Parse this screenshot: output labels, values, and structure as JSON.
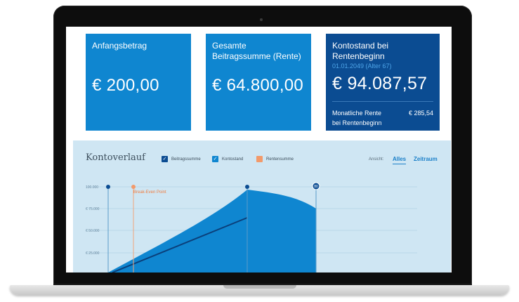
{
  "cards": [
    {
      "label": "Anfangsbetrag",
      "value": "€ 200,00"
    },
    {
      "label": "Gesamte Beitragssumme (Rente)",
      "value": "€ 64.800,00"
    },
    {
      "label": "Kontostand bei Rentenbeginn",
      "sublabel": "01.01.2049 (Alter 67)",
      "value": "€ 94.087,57",
      "rente_label": "Monatliche Rente bei Rentenbeginn",
      "rente_value": "€ 285,54"
    }
  ],
  "chart": {
    "title": "Kontoverlauf",
    "legend": [
      {
        "label": "Beitragssumme",
        "color": "#0b4c92",
        "checked": true
      },
      {
        "label": "Kontostand",
        "color": "#0f86d0",
        "checked": true
      },
      {
        "label": "Rentensumme",
        "color": "#f29a6b",
        "checked": false
      }
    ],
    "view_label": "Ansicht:",
    "view_options": [
      "Alles",
      "Zeitraum"
    ],
    "view_selected": "Alles",
    "check_glyph": "✓",
    "annotation": "Break-Even Point",
    "marker_label": "80",
    "yticks": [
      "100.000",
      "€ 75.000",
      "€ 50.000",
      "€ 25.000"
    ]
  },
  "chart_data": {
    "type": "area",
    "title": "Kontoverlauf",
    "x_fraction_note": "",
    "series": [
      {
        "name": "Kontostand",
        "x": [
          0.13,
          0.58,
          0.75,
          0.86
        ],
        "values": [
          0,
          94000,
          90000,
          80000
        ]
      },
      {
        "name": "Beitragssumme",
        "x": [
          0.13,
          0.58
        ],
        "values": [
          0,
          64800
        ]
      }
    ],
    "ylim": [
      0,
      100000
    ],
    "yticks": [
      100000,
      75000,
      50000,
      25000
    ]
  }
}
